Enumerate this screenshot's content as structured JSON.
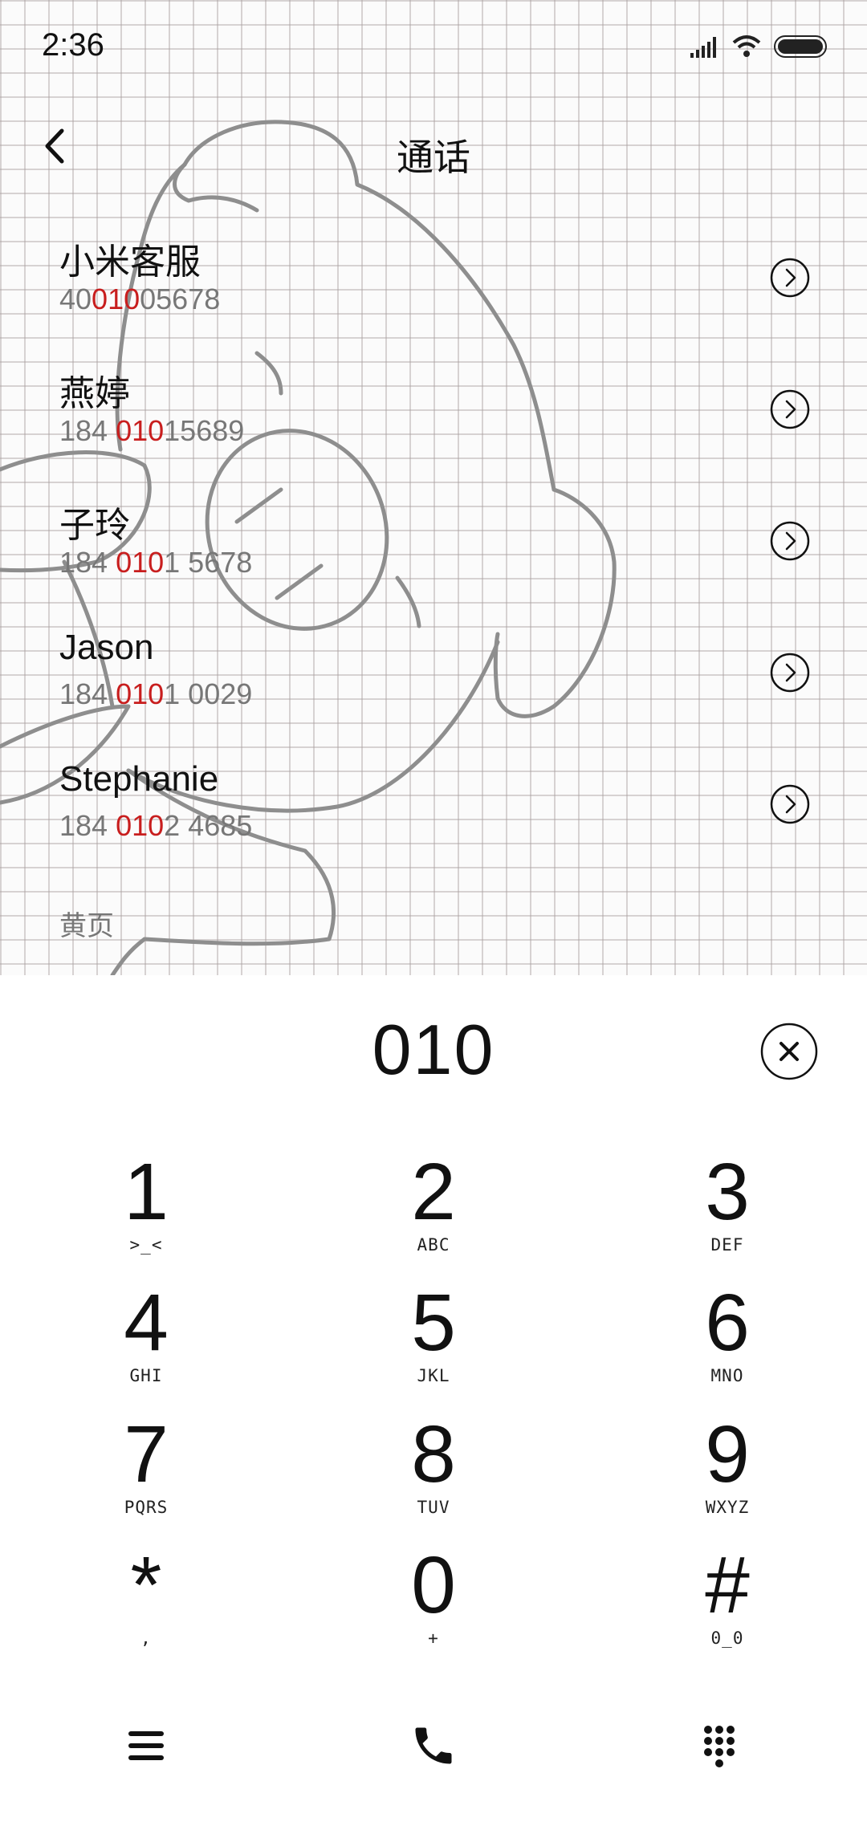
{
  "status_bar": {
    "time": "2:36"
  },
  "header": {
    "title": "通话"
  },
  "contacts": [
    {
      "name": "小米客服",
      "number_pre": "40",
      "number_match": "010",
      "number_post": "05678"
    },
    {
      "name": "燕婷",
      "number_pre": "184 ",
      "number_match": "010",
      "number_post": "15689"
    },
    {
      "name": "子玲",
      "number_pre": "184 ",
      "number_match": "010",
      "number_post": "1 5678"
    },
    {
      "name": "Jason",
      "number_pre": "184 ",
      "number_match": "010",
      "number_post": "1 0029"
    },
    {
      "name": "Stephanie",
      "number_pre": "184 ",
      "number_match": "010",
      "number_post": "2 4685"
    }
  ],
  "section_label": "黄页",
  "dialer": {
    "input": "010",
    "keys": [
      {
        "digit": "1",
        "letters": ">_<"
      },
      {
        "digit": "2",
        "letters": "ABC"
      },
      {
        "digit": "3",
        "letters": "DEF"
      },
      {
        "digit": "4",
        "letters": "GHI"
      },
      {
        "digit": "5",
        "letters": "JKL"
      },
      {
        "digit": "6",
        "letters": "MNO"
      },
      {
        "digit": "7",
        "letters": "PQRS"
      },
      {
        "digit": "8",
        "letters": "TUV"
      },
      {
        "digit": "9",
        "letters": "WXYZ"
      },
      {
        "digit": "*",
        "letters": ","
      },
      {
        "digit": "0",
        "letters": "+"
      },
      {
        "digit": "#",
        "letters": "0_0"
      }
    ]
  },
  "colors": {
    "match_highlight": "#c81e1e",
    "text_primary": "#111111",
    "text_secondary": "#777777"
  },
  "icons": {
    "status": [
      "signal-icon",
      "wifi-icon",
      "battery-icon"
    ],
    "header": "back-chevron-icon",
    "row_action": "chevron-circle-right-icon",
    "clear": "close-circle-icon",
    "bottom": [
      "menu-icon",
      "phone-icon",
      "keypad-icon"
    ]
  }
}
